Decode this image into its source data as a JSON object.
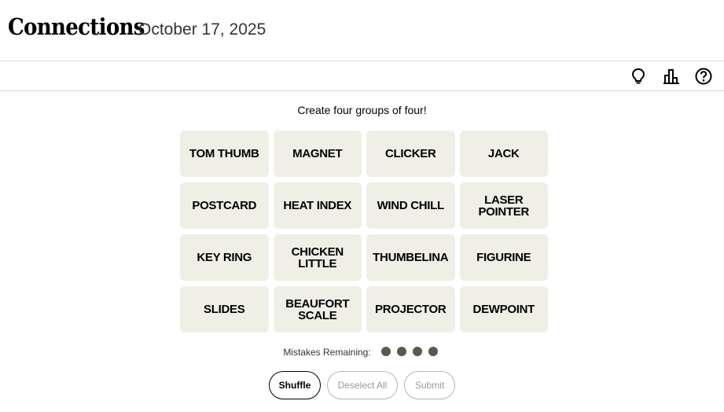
{
  "header": {
    "title": "Connections",
    "date": "October 17, 2025"
  },
  "toolbar": {
    "icons": [
      "lightbulb-icon",
      "bar-chart-icon",
      "help-icon"
    ]
  },
  "instructions": "Create four groups of four!",
  "tiles": [
    "TOM THUMB",
    "MAGNET",
    "CLICKER",
    "JACK",
    "POSTCARD",
    "HEAT INDEX",
    "WIND CHILL",
    "LASER POINTER",
    "KEY RING",
    "CHICKEN LITTLE",
    "THUMBELINA",
    "FIGURINE",
    "SLIDES",
    "BEAUFORT\nSCALE",
    "PROJECTOR",
    "DEWPOINT"
  ],
  "mistakes": {
    "label": "Mistakes Remaining:",
    "remaining": 4
  },
  "buttons": {
    "shuffle": "Shuffle",
    "deselect": "Deselect All",
    "submit": "Submit"
  },
  "colors": {
    "tile_bg": "#efefe6",
    "dot": "#5a594e",
    "divider": "#d6d6d6"
  }
}
